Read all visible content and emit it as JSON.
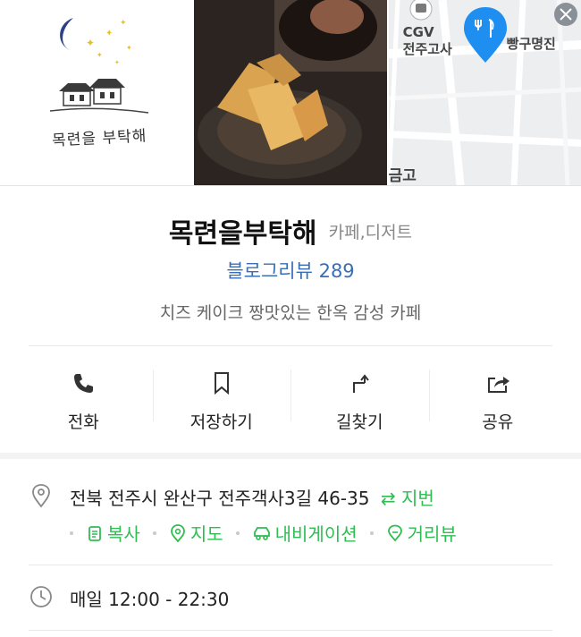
{
  "photos": {
    "logo_text": "목련을 부탁해",
    "map": {
      "cgv_label": "CGV",
      "cgv_sub": "전주고사",
      "right_label": "빵구명진",
      "bottom_label": "금고"
    }
  },
  "place": {
    "name": "목련을부탁해",
    "category": "카페,디저트",
    "blog_review": "블로그리뷰 289",
    "description": "치즈 케이크 짱맛있는 한옥 감성 카페"
  },
  "actions": [
    {
      "label": "전화",
      "icon": "phone-icon"
    },
    {
      "label": "저장하기",
      "icon": "bookmark-icon"
    },
    {
      "label": "길찾기",
      "icon": "directions-icon"
    },
    {
      "label": "공유",
      "icon": "share-icon"
    }
  ],
  "address": {
    "text": "전북 전주시 완산구 전주객사3길 46-35",
    "jibeon_label": "지번",
    "links": [
      "복사",
      "지도",
      "내비게이션",
      "거리뷰"
    ]
  },
  "hours": {
    "text": "매일 12:00 - 22:30"
  },
  "colors": {
    "accent_green": "#2fbd52",
    "review_blue": "#3a6fb5",
    "map_pin_blue": "#1e8ff0"
  }
}
